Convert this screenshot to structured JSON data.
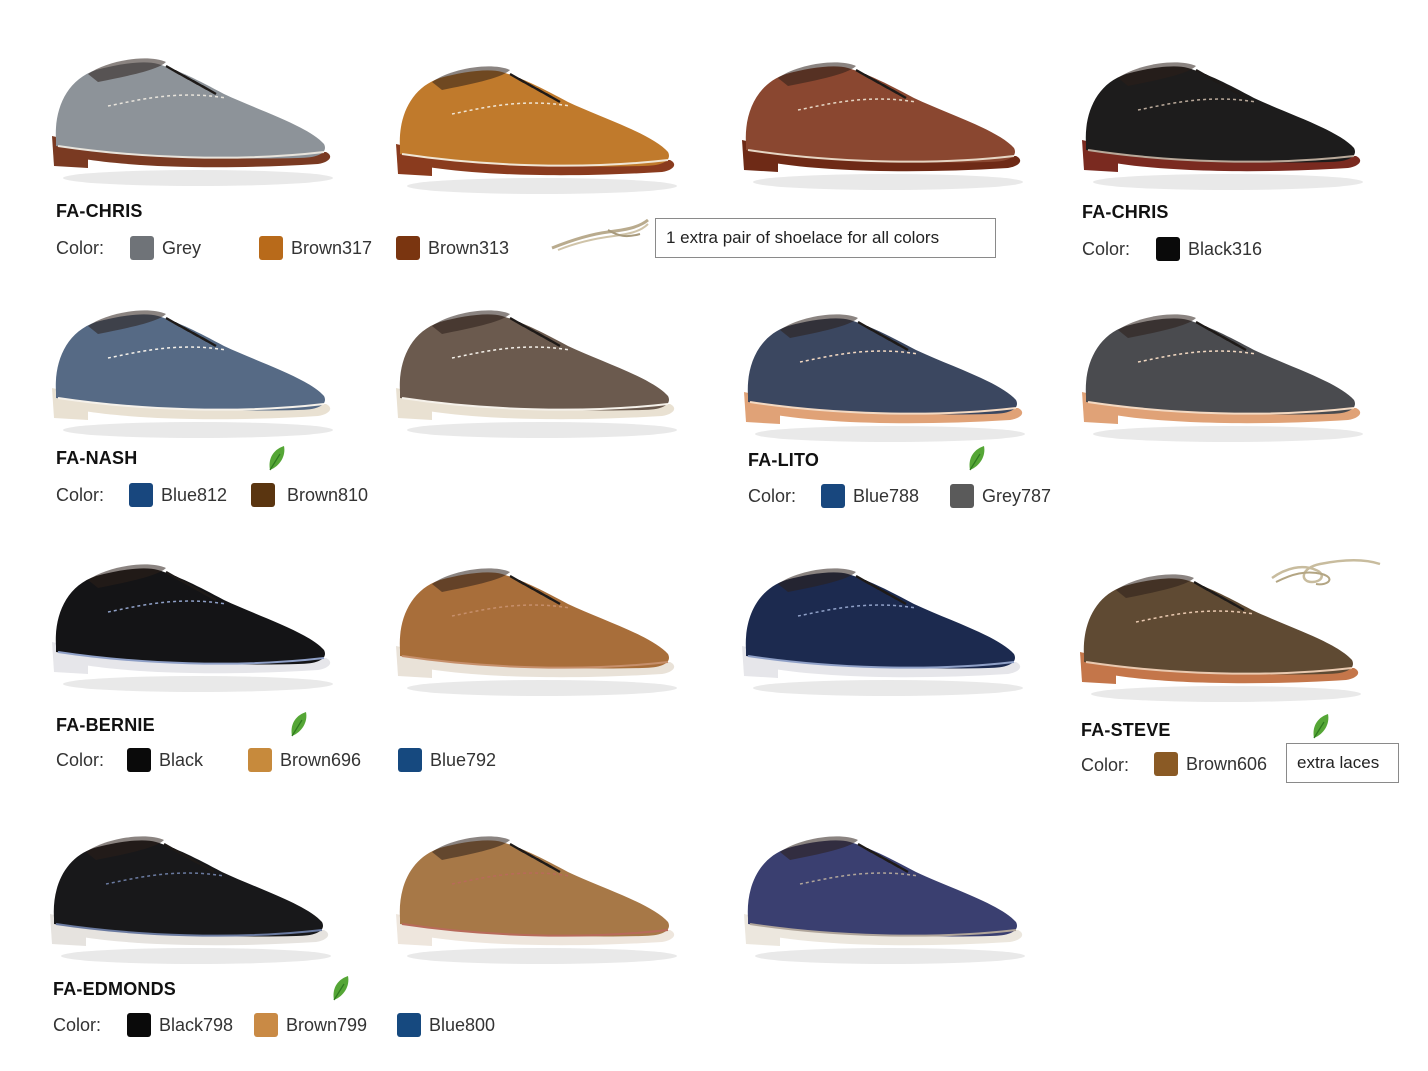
{
  "color_label": "Color:",
  "notes": {
    "shoelace_note": "1 extra pair of shoelace for all colors",
    "extra_laces": "extra laces"
  },
  "icons": {
    "eco": "leaf-icon",
    "laces": "shoelace-icon"
  },
  "groups": [
    {
      "model": "FA-CHRIS",
      "swatches": [
        {
          "name": "Grey",
          "color": "#6f7378"
        },
        {
          "name": "Brown317",
          "color": "#b86a1a"
        },
        {
          "name": "Brown313",
          "color": "#7a3510"
        }
      ]
    },
    {
      "model": "FA-CHRIS",
      "swatches": [
        {
          "name": "Black316",
          "color": "#0a0a0a"
        }
      ]
    },
    {
      "model": "FA-NASH",
      "swatches": [
        {
          "name": "Blue812",
          "color": "#18477e"
        },
        {
          "name": "Brown810",
          "color": "#5a3510"
        }
      ]
    },
    {
      "model": "FA-LITO",
      "swatches": [
        {
          "name": "Blue788",
          "color": "#18477e"
        },
        {
          "name": "Grey787",
          "color": "#5a5a5a"
        }
      ]
    },
    {
      "model": "FA-BERNIE",
      "swatches": [
        {
          "name": "Black",
          "color": "#0a0a0a"
        },
        {
          "name": "Brown696",
          "color": "#c78a3c"
        },
        {
          "name": "Blue792",
          "color": "#16497f"
        }
      ]
    },
    {
      "model": "FA-STEVE",
      "swatches": [
        {
          "name": "Brown606",
          "color": "#8a5a25"
        }
      ]
    },
    {
      "model": "FA-EDMONDS",
      "swatches": [
        {
          "name": "Black798",
          "color": "#0a0a0a"
        },
        {
          "name": "Brown799",
          "color": "#c98a45"
        },
        {
          "name": "Blue800",
          "color": "#16497f"
        }
      ]
    }
  ],
  "shoes": [
    {
      "upper": "#8d9399",
      "sole": "#7a3a22",
      "trim": "#e8e4dc"
    },
    {
      "upper": "#c07a2c",
      "sole": "#8a3b1e",
      "trim": "#f0e6d5"
    },
    {
      "upper": "#8a4730",
      "sole": "#6e2a16",
      "trim": "#e6d6c4"
    },
    {
      "upper": "#1d1c1c",
      "sole": "#7a2a20",
      "trim": "#b9a99a"
    },
    {
      "upper": "#566a85",
      "sole": "#e9e1d2",
      "trim": "#f5f1ea"
    },
    {
      "upper": "#6b5a4e",
      "sole": "#e9e1d2",
      "trim": "#f5f1ea"
    },
    {
      "upper": "#3b4760",
      "sole": "#e0a277",
      "trim": "#f3d9c2"
    },
    {
      "upper": "#4a4b4f",
      "sole": "#e0a277",
      "trim": "#f3d9c2"
    },
    {
      "upper": "#141416",
      "sole": "#e6e6ea",
      "trim": "#8fa0c7"
    },
    {
      "upper": "#a86e3a",
      "sole": "#e9e2d8",
      "trim": "#c68f6b"
    },
    {
      "upper": "#1c2a4f",
      "sole": "#e6e6ea",
      "trim": "#8fa0c7"
    },
    {
      "upper": "#5f4a33",
      "sole": "#c4764a",
      "trim": "#e9c9b0"
    },
    {
      "upper": "#18181a",
      "sole": "#e6e3df",
      "trim": "#6a7aa0"
    },
    {
      "upper": "#a77847",
      "sole": "#eee6dd",
      "trim": "#b86a5a"
    },
    {
      "upper": "#3a3f70",
      "sole": "#ece7de",
      "trim": "#b0a59a"
    }
  ]
}
